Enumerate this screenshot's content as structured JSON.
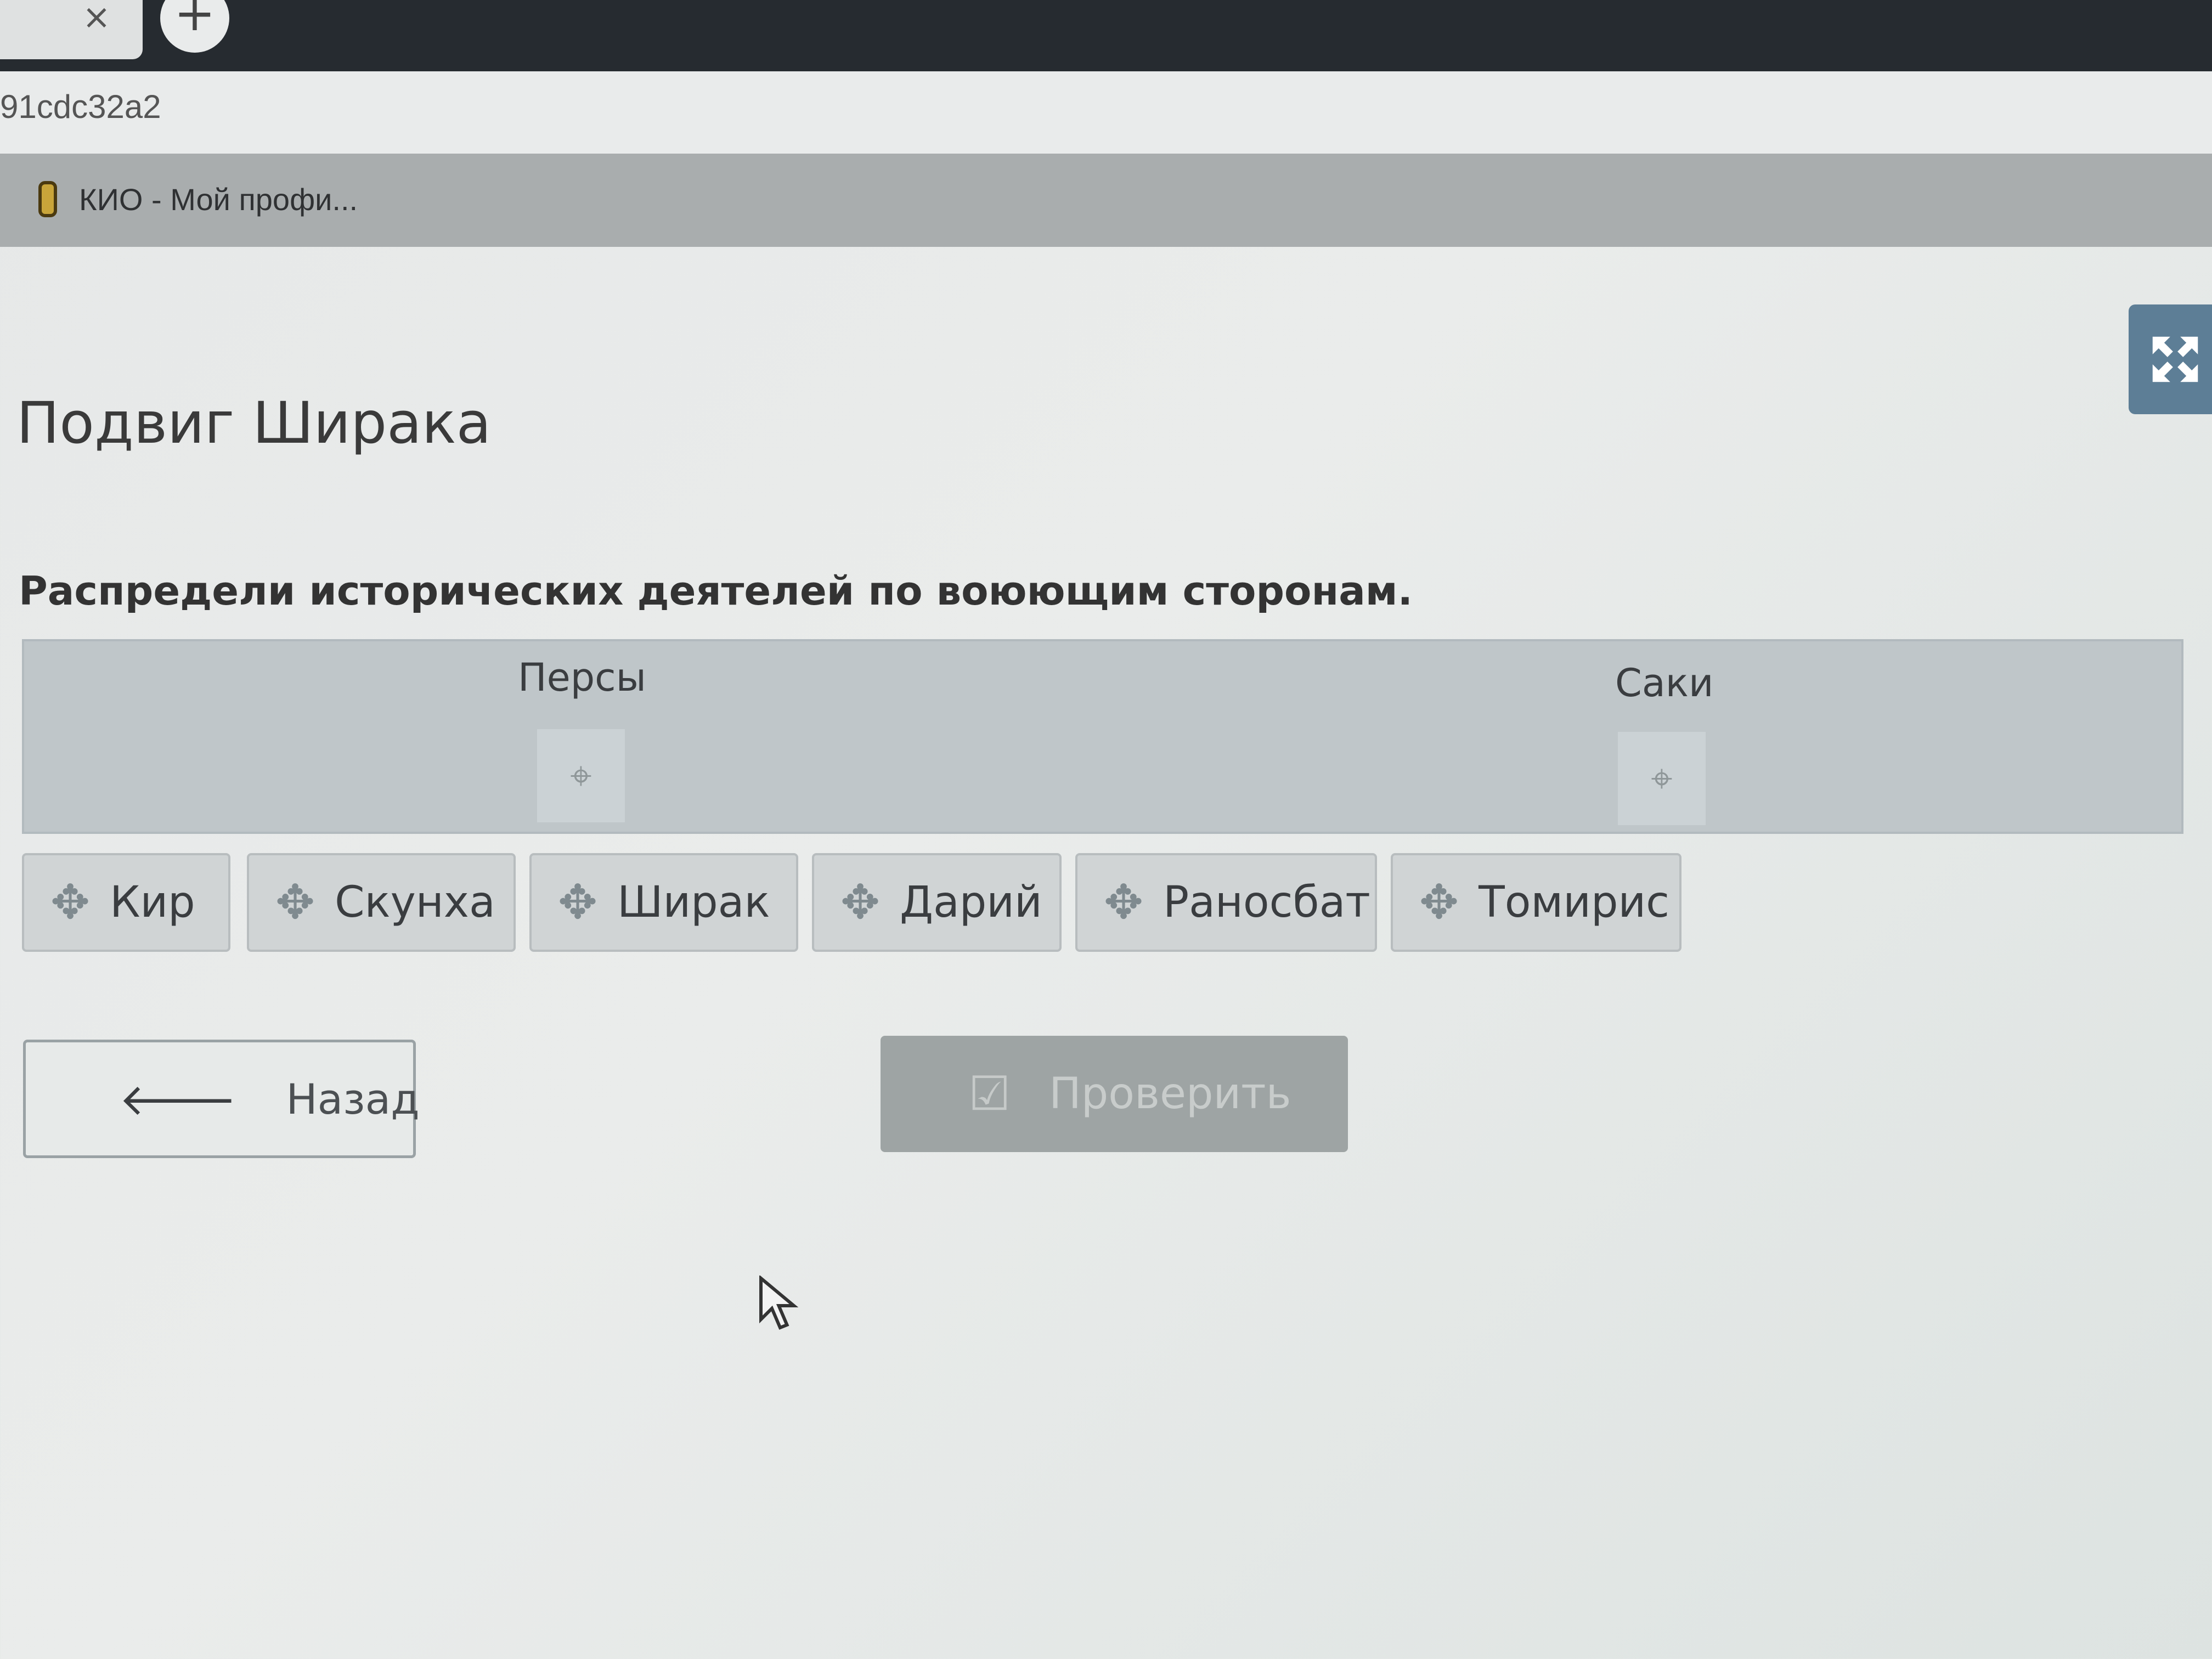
{
  "browser": {
    "tab_close_glyph": "×",
    "new_tab_glyph": "+",
    "url_fragment": "91cdc32a2",
    "bookmark_label": "КИО - Мой профи..."
  },
  "page": {
    "title": "Подвиг Ширака",
    "instruction": "Распредели исторических деятелей по воюющим сторонам.",
    "fullscreen_icon": "expand-arrows-icon"
  },
  "dropzones": [
    {
      "label": "Персы",
      "slot_icon": "⌖"
    },
    {
      "label": "Саки",
      "slot_icon": "⌖"
    }
  ],
  "cards": [
    {
      "label": "Кир",
      "icon": "✥"
    },
    {
      "label": "Скунха",
      "icon": "✥"
    },
    {
      "label": "Ширак",
      "icon": "✥"
    },
    {
      "label": "Дарий",
      "icon": "✥"
    },
    {
      "label": "Раносбат",
      "icon": "✥"
    },
    {
      "label": "Томирис",
      "icon": "✥"
    }
  ],
  "buttons": {
    "back_label": "Назад",
    "back_icon": "🡐",
    "check_label": "Проверить",
    "check_icon": "☑"
  },
  "colors": {
    "accent": "#5d7e96",
    "disabled_button": "#9ea4a4"
  }
}
